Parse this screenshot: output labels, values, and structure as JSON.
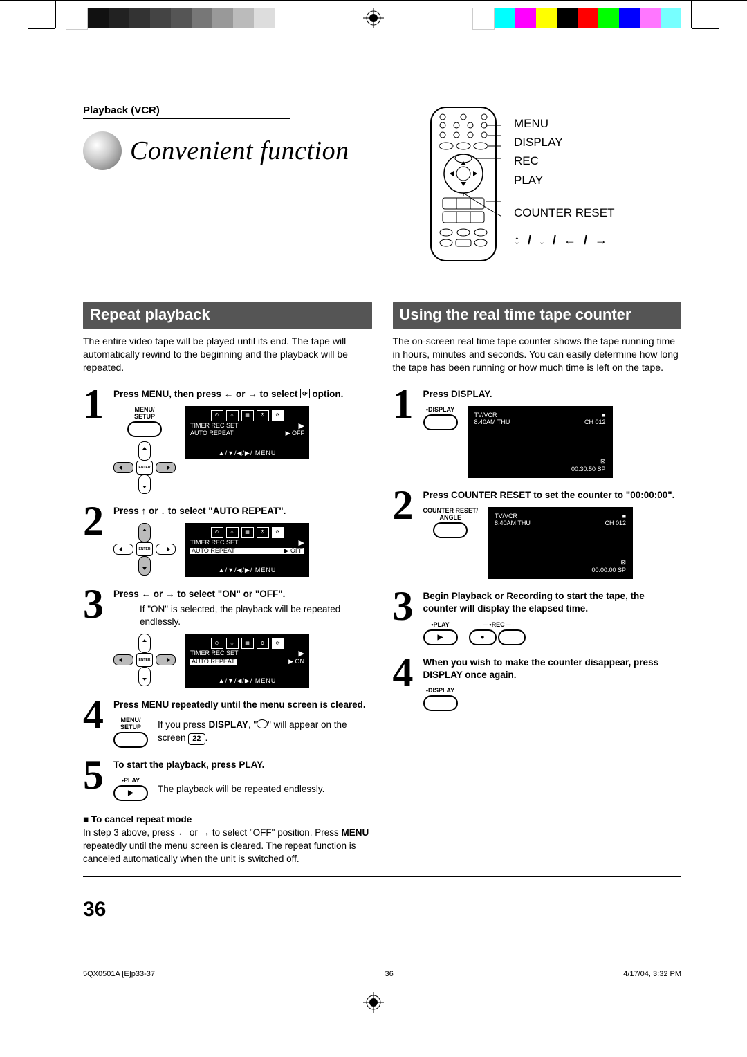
{
  "breadcrumb": "Playback (VCR)",
  "title": "Convenient function",
  "remote": {
    "labels": [
      "MENU",
      "DISPLAY",
      "REC",
      "PLAY",
      "COUNTER RESET"
    ],
    "arrow_glyphs": "↕ / ↓ / ← / →"
  },
  "left": {
    "heading": "Repeat playback",
    "intro": "The entire video tape will be played until its end. The tape will automatically rewind to the beginning and the playback will be repeated.",
    "steps": {
      "s1": "Press MENU, then press ← or → to select ",
      "s1_tail": " option.",
      "s2": "Press ↑ or ↓ to select \"AUTO REPEAT\".",
      "s3": "Press ← or → to select \"ON\" or \"OFF\".",
      "s3_sub": "If \"ON\" is selected, the playback will be repeated endlessly.",
      "s4": "Press MENU repeatedly until the menu screen is cleared.",
      "s4_sub_a": "If you press ",
      "s4_sub_b": "DISPLAY",
      "s4_sub_c": ", \"",
      "s4_sub_d": "\" will appear on the screen ",
      "s5": "To start the playback, press PLAY.",
      "s5_sub": "The playback will be repeated endlessly."
    },
    "cancel": {
      "head": "To cancel repeat mode",
      "body_a": "In step 3 above, press ← or → to select \"OFF\" position. Press ",
      "body_b": "MENU",
      "body_c": " repeatedly until the menu screen is cleared. The repeat function is canceled automatically when the unit is switched off."
    },
    "osd": {
      "opt1": "TIMER REC SET",
      "opt2": "AUTO REPEAT",
      "val_off": "▶ OFF",
      "val_on": "▶ ON",
      "menuhint": "▲/▼/◀/▶/ MENU"
    },
    "btn_menu": "MENU/\nSETUP",
    "btn_play": "•PLAY",
    "play_glyph": "▶",
    "enter_label": "ENTER",
    "pageref": "22"
  },
  "right": {
    "heading": "Using the real time tape counter",
    "intro": "The on-screen real time tape counter shows the tape running time in hours, minutes and seconds. You can easily determine how long the tape has been running or how much time is left on the tape.",
    "steps": {
      "s1": "Press DISPLAY.",
      "s2": "Press COUNTER RESET to set the counter to \"00:00:00\".",
      "s3": "Begin Playback or Recording to start the tape, the counter will display the elapsed time.",
      "s4": "When you wish to make the counter disappear, press DISPLAY once again."
    },
    "btn_display": "•DISPLAY",
    "btn_counter": "COUNTER RESET/\nANGLE",
    "btn_play": "•PLAY",
    "btn_rec": "•REC",
    "play_glyph": "▶",
    "rec_glyph": "●",
    "tv1": {
      "l1a": "TV/VCR",
      "l1b": "■",
      "l2a": "8:40AM  THU",
      "l2b": "CH 012",
      "l3": "⊠",
      "l4": "00:30:50  SP"
    },
    "tv2": {
      "l1a": "TV/VCR",
      "l1b": "■",
      "l2a": "8:40AM  THU",
      "l2b": "CH 012",
      "l3": "⊠",
      "l4": "00:00:00  SP"
    }
  },
  "pagenum": "36",
  "footer": {
    "left": "5QX0501A [E]p33-37",
    "mid": "36",
    "right": "4/17/04, 3:32 PM"
  }
}
